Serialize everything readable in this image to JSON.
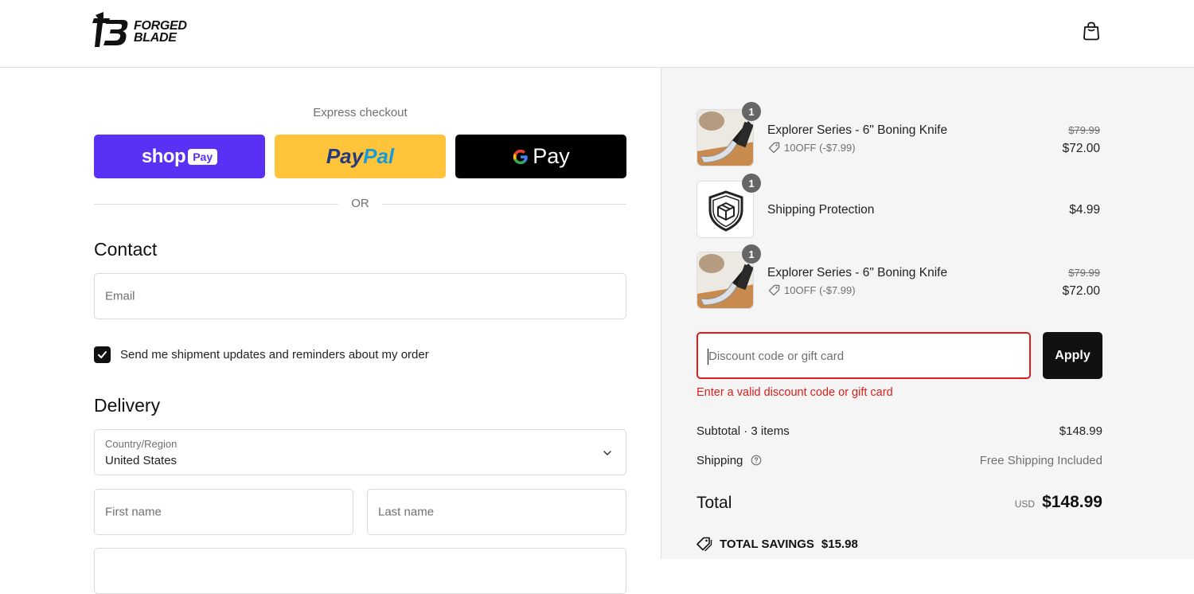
{
  "header": {
    "logo_line1": "FORGED",
    "logo_line2": "BLADE",
    "cart_icon": "shopping-bag-icon"
  },
  "express": {
    "label": "Express checkout",
    "shop_label": "shop",
    "shop_pay": "Pay",
    "paypal_part1": "Pay",
    "paypal_part2": "Pal",
    "gpay_label": "Pay",
    "or_label": "OR"
  },
  "contact": {
    "title": "Contact",
    "email_placeholder": "Email",
    "updates_label": "Send me shipment updates and reminders about my order",
    "updates_checked": true
  },
  "delivery": {
    "title": "Delivery",
    "country_label": "Country/Region",
    "country_value": "United States",
    "first_name_placeholder": "First name",
    "last_name_placeholder": "Last name"
  },
  "order": {
    "items": [
      {
        "name": "Explorer Series - 6\" Boning Knife",
        "quantity": "1",
        "discount": "10OFF (-$7.99)",
        "old_price": "$79.99",
        "price": "$72.00"
      },
      {
        "name": "Shipping Protection",
        "quantity": "1",
        "price": "$4.99"
      },
      {
        "name": "Explorer Series - 6\" Boning Knife",
        "quantity": "1",
        "discount": "10OFF (-$7.99)",
        "old_price": "$79.99",
        "price": "$72.00"
      }
    ],
    "discount_placeholder": "Discount code or gift card",
    "apply_label": "Apply",
    "discount_error": "Enter a valid discount code or gift card",
    "subtotal_label": "Subtotal · 3 items",
    "subtotal_value": "$148.99",
    "shipping_label": "Shipping",
    "shipping_value": "Free Shipping Included",
    "total_label": "Total",
    "total_currency": "USD",
    "total_value": "$148.99",
    "savings_label": "TOTAL SAVINGS",
    "savings_value": "$15.98"
  },
  "colors": {
    "shop_pay": "#5a31f4",
    "paypal": "#ffc439",
    "error": "#dd1d1d"
  }
}
